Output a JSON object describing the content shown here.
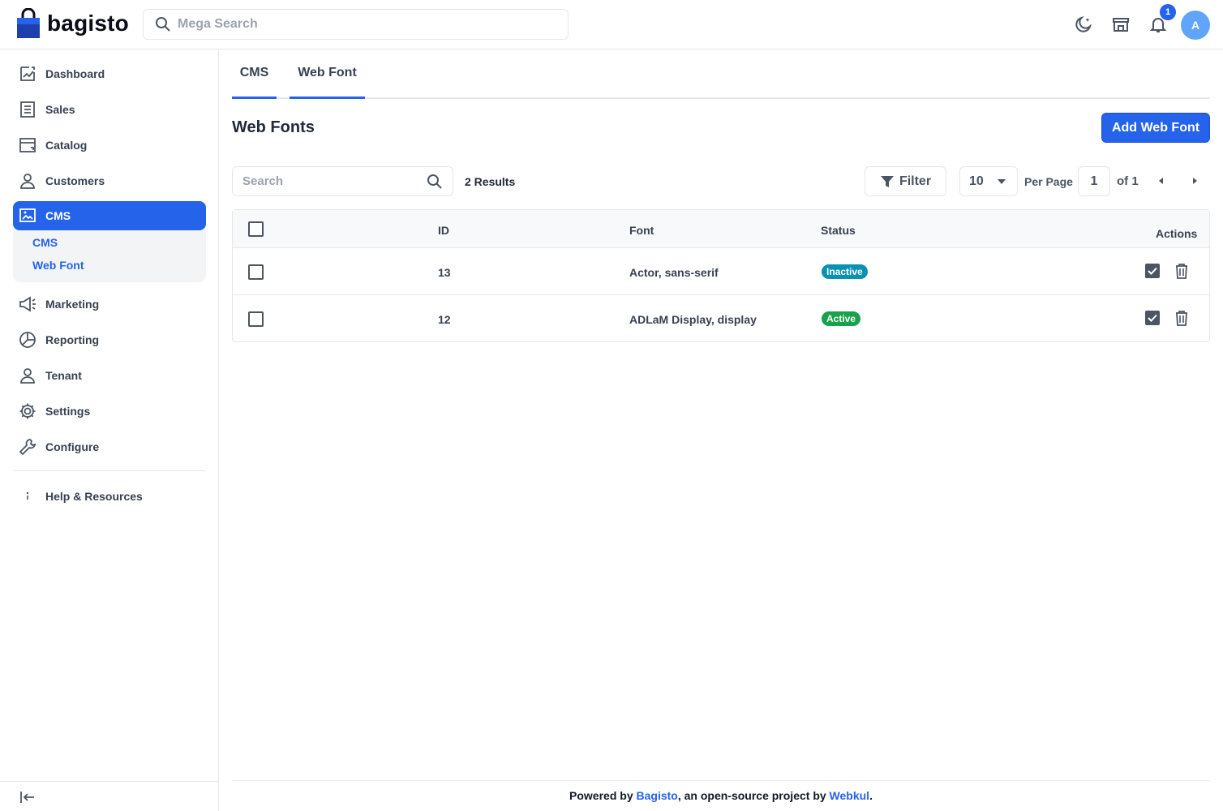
{
  "app": {
    "brand": "bagisto",
    "search_placeholder": "Mega Search",
    "notification_count": "1",
    "avatar_initial": "A"
  },
  "sidebar": {
    "items": [
      {
        "label": "Dashboard",
        "icon": "dashboard-icon"
      },
      {
        "label": "Sales",
        "icon": "sales-icon"
      },
      {
        "label": "Catalog",
        "icon": "catalog-icon"
      },
      {
        "label": "Customers",
        "icon": "customers-icon"
      },
      {
        "label": "CMS",
        "icon": "cms-icon"
      },
      {
        "label": "Marketing",
        "icon": "marketing-icon"
      },
      {
        "label": "Reporting",
        "icon": "reporting-icon"
      },
      {
        "label": "Tenant",
        "icon": "tenant-icon"
      },
      {
        "label": "Settings",
        "icon": "settings-icon"
      },
      {
        "label": "Configure",
        "icon": "configure-icon"
      }
    ],
    "cms_subitems": [
      "CMS",
      "Web Font"
    ],
    "help": "Help & Resources"
  },
  "tabs": [
    "CMS",
    "Web Font"
  ],
  "page": {
    "title": "Web Fonts",
    "add_button": "Add Web Font",
    "search_placeholder": "Search",
    "results": "2 Results",
    "filter": "Filter",
    "per_page_value": "10",
    "per_page_label": "Per Page",
    "current_page": "1",
    "of_pages": "of 1"
  },
  "table": {
    "headers": [
      "ID",
      "Font",
      "Status",
      "Actions"
    ],
    "rows": [
      {
        "id": "13",
        "font": "Actor, sans-serif",
        "status": "Inactive"
      },
      {
        "id": "12",
        "font": "ADLaM Display, display",
        "status": "Active"
      }
    ]
  },
  "footer": {
    "prefix": "Powered by ",
    "brand_link": "Bagisto",
    "middle": ", an open-source project by ",
    "company_link": "Webkul",
    "suffix": "."
  },
  "colors": {
    "primary": "#2563eb",
    "inactive": "#0891b2",
    "active": "#16a34a"
  }
}
